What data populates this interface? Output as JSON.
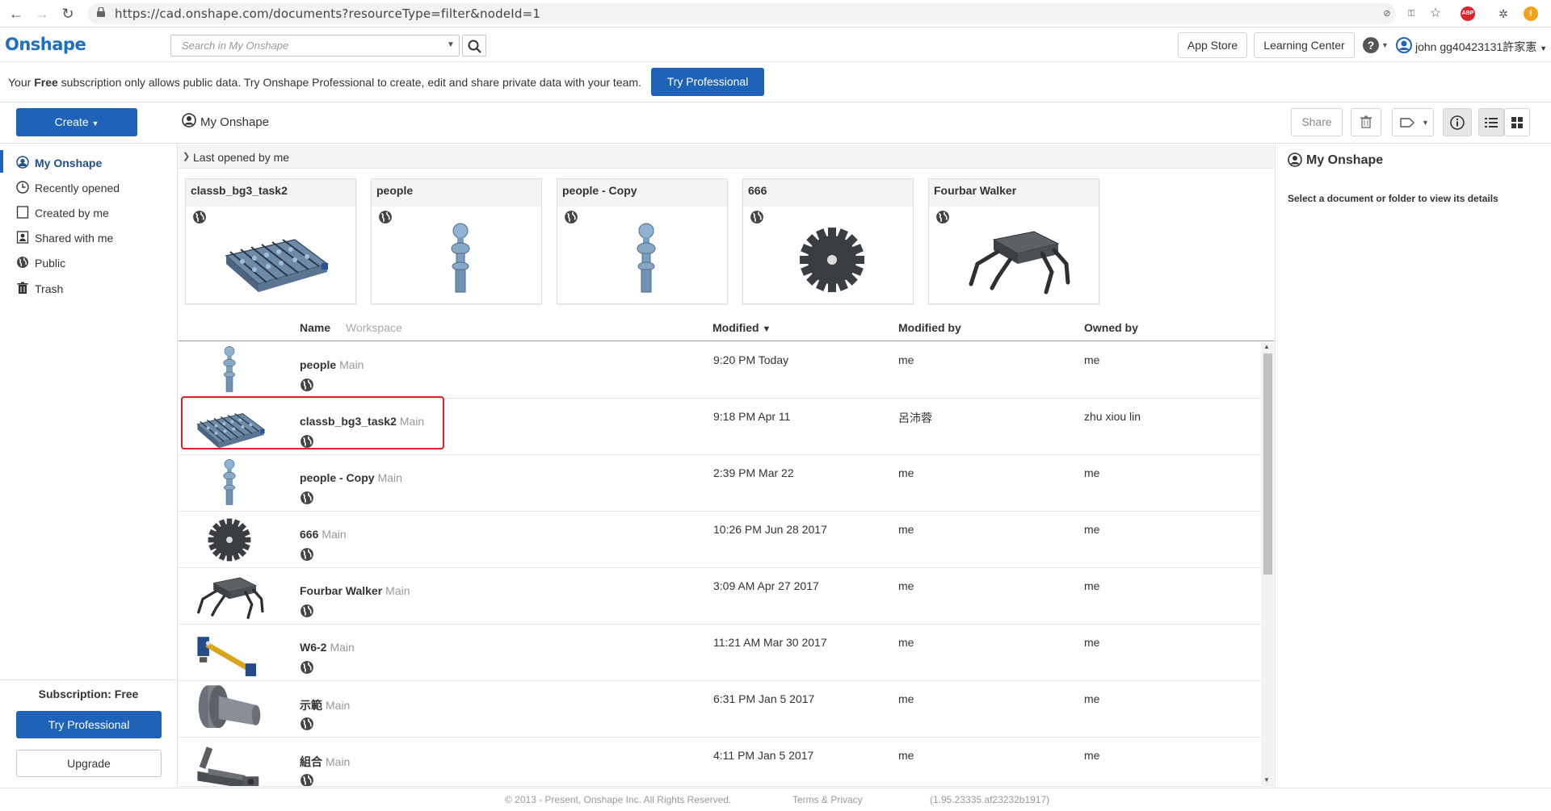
{
  "browser": {
    "url": "https://cad.onshape.com/documents?resourceType=filter&nodeId=1",
    "ext_abp": "ABP"
  },
  "header": {
    "logo": "Onshape",
    "search_placeholder": "Search in My Onshape",
    "app_store": "App Store",
    "learning_center": "Learning Center",
    "help_symbol": "?",
    "user_name": "john gg40423131許家憲"
  },
  "banner": {
    "text_pre": "Your ",
    "text_bold": "Free",
    "text_post": " subscription only allows public data. Try Onshape Professional to create, edit and share private data with your team.",
    "button": "Try Professional"
  },
  "toolbar": {
    "create": "Create",
    "breadcrumb": "My Onshape",
    "share": "Share"
  },
  "sidebar": {
    "items": [
      {
        "label": "My Onshape",
        "icon": "user-icon",
        "active": true
      },
      {
        "label": "Recently opened",
        "icon": "clock-icon"
      },
      {
        "label": "Created by me",
        "icon": "document-icon"
      },
      {
        "label": "Shared with me",
        "icon": "shared-icon"
      },
      {
        "label": "Public",
        "icon": "globe-icon"
      },
      {
        "label": "Trash",
        "icon": "trash-icon"
      }
    ],
    "subscription_label": "Subscription: Free",
    "try_professional": "Try Professional",
    "upgrade": "Upgrade"
  },
  "recent": {
    "title": "Last opened by me",
    "cards": [
      {
        "name": "classb_bg3_task2",
        "thumb": "foosball-table"
      },
      {
        "name": "people",
        "thumb": "foosball-player"
      },
      {
        "name": "people - Copy",
        "thumb": "foosball-player"
      },
      {
        "name": "666",
        "thumb": "gear"
      },
      {
        "name": "Fourbar Walker",
        "thumb": "walker"
      }
    ]
  },
  "table": {
    "columns": {
      "name": "Name",
      "workspace": "Workspace",
      "modified": "Modified",
      "modified_by": "Modified by",
      "owned_by": "Owned by"
    },
    "rows": [
      {
        "name": "people",
        "workspace": "Main",
        "modified": "9:20 PM Today",
        "modified_by": "me",
        "owned_by": "me",
        "thumb": "foosball-player"
      },
      {
        "name": "classb_bg3_task2",
        "workspace": "Main",
        "modified": "9:18 PM Apr 11",
        "modified_by": "呂沛蓉",
        "owned_by": "zhu xiou lin",
        "thumb": "foosball-table"
      },
      {
        "name": "people - Copy",
        "workspace": "Main",
        "modified": "2:39 PM Mar 22",
        "modified_by": "me",
        "owned_by": "me",
        "thumb": "foosball-player"
      },
      {
        "name": "666",
        "workspace": "Main",
        "modified": "10:26 PM Jun 28 2017",
        "modified_by": "me",
        "owned_by": "me",
        "thumb": "gear"
      },
      {
        "name": "Fourbar Walker",
        "workspace": "Main",
        "modified": "3:09 AM Apr 27 2017",
        "modified_by": "me",
        "owned_by": "me",
        "thumb": "walker"
      },
      {
        "name": "W6-2",
        "workspace": "Main",
        "modified": "11:21 AM Mar 30 2017",
        "modified_by": "me",
        "owned_by": "me",
        "thumb": "linkage"
      },
      {
        "name": "示範",
        "workspace": "Main",
        "modified": "6:31 PM Jan 5 2017",
        "modified_by": "me",
        "owned_by": "me",
        "thumb": "shaft"
      },
      {
        "name": "組合",
        "workspace": "Main",
        "modified": "4:11 PM Jan 5 2017",
        "modified_by": "me",
        "owned_by": "me",
        "thumb": "clamp"
      }
    ]
  },
  "info": {
    "title": "My Onshape",
    "text": "Select a document or folder to view its details"
  },
  "footer": {
    "copyright": "© 2013 - Present, Onshape Inc. All Rights Reserved.",
    "terms": "Terms & Privacy",
    "version": "(1.95.23335.af23232b1917)"
  }
}
